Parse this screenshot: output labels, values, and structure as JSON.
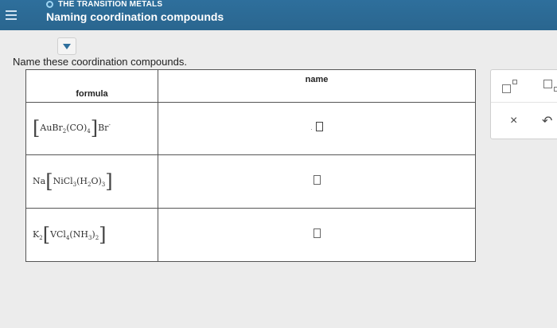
{
  "header": {
    "topic": "THE TRANSITION METALS",
    "title": "Naming coordination compounds"
  },
  "question": {
    "prompt": "Name these coordination compounds."
  },
  "table": {
    "col_formula": "formula",
    "col_name": "name",
    "rows": [
      {
        "formula_text": "[AuBr2(CO)4]Br-",
        "answer": ""
      },
      {
        "formula_text": "Na[NiCl3(H2O)3]",
        "answer": ""
      },
      {
        "formula_text": "K2[VCl4(NH3)2]",
        "answer": ""
      }
    ]
  },
  "formula_parts": {
    "r1": {
      "a": "AuBr",
      "s1": "2",
      "b": "(CO)",
      "s2": "4",
      "c": "Br",
      "sup": "-"
    },
    "r2": {
      "pre": "Na",
      "a": "NiCl",
      "s1": "3",
      "b": "(H",
      "s2": "2",
      "c": "O)",
      "s3": "3"
    },
    "r3": {
      "pre": "K",
      "s0": "2",
      "a": "VCl",
      "s1": "4",
      "b": "(NH",
      "s2": "3",
      "c": ")",
      "s3": "2"
    }
  },
  "tools": {
    "close": "×",
    "undo": "↶"
  },
  "colors": {
    "header_bg": "#2e6f9c",
    "accent": "#2e6f9c"
  }
}
